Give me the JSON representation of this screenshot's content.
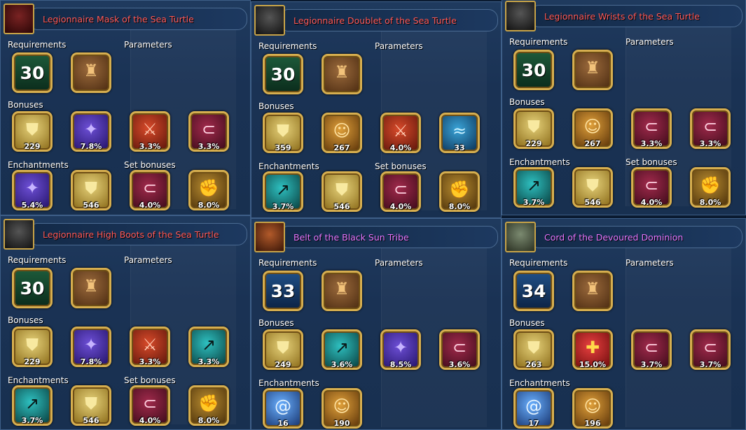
{
  "labels": {
    "requirements": "Requirements",
    "parameters": "Parameters",
    "bonuses": "Bonuses",
    "enchantments": "Enchantments",
    "set_bonuses": "Set bonuses"
  },
  "panels": [
    {
      "title": "Legionnaire Mask of the Sea Turtle",
      "title_color": "#ff5b5b",
      "level": "30",
      "bonuses": [
        "229",
        "7.8%",
        "3.3%",
        "3.3%"
      ],
      "bonus_icons": [
        "shield-icon",
        "magic-icon",
        "sword-icon",
        "crit-icon"
      ],
      "enchantments": [
        "5.4%",
        "546"
      ],
      "enchantment_icons": [
        "magic-icon",
        "shield-icon"
      ],
      "set_bonuses": [
        "4.0%",
        "8.0%"
      ],
      "set_bonus_icons": [
        "crit-icon",
        "arm-icon"
      ]
    },
    {
      "title": "Legionnaire Doublet of the Sea Turtle",
      "title_color": "#ff5b5b",
      "level": "30",
      "bonuses": [
        "359",
        "267",
        "4.0%",
        "33"
      ],
      "bonus_icons": [
        "shield-icon",
        "hero-icon",
        "sword-icon",
        "water-icon"
      ],
      "enchantments": [
        "3.7%",
        "546"
      ],
      "enchantment_icons": [
        "run-icon",
        "shield-icon"
      ],
      "set_bonuses": [
        "4.0%",
        "8.0%"
      ],
      "set_bonus_icons": [
        "crit-icon",
        "arm-icon"
      ]
    },
    {
      "title": "Legionnaire Wrists of the Sea Turtle",
      "title_color": "#ff5b5b",
      "level": "30",
      "bonuses": [
        "229",
        "267",
        "3.3%",
        "3.3%"
      ],
      "bonus_icons": [
        "shield-icon",
        "hero-icon",
        "crit-icon",
        "crit-icon"
      ],
      "enchantments": [
        "3.7%",
        "546"
      ],
      "enchantment_icons": [
        "run-icon",
        "shield-icon"
      ],
      "set_bonuses": [
        "4.0%",
        "8.0%"
      ],
      "set_bonus_icons": [
        "crit-icon",
        "arm-icon"
      ]
    },
    {
      "title": "Legionnaire High Boots of the Sea Turtle",
      "title_color": "#ff5b5b",
      "level": "30",
      "bonuses": [
        "229",
        "7.8%",
        "3.3%",
        "3.3%"
      ],
      "bonus_icons": [
        "shield-icon",
        "magic-icon",
        "sword-icon",
        "run-icon"
      ],
      "enchantments": [
        "3.7%",
        "546"
      ],
      "enchantment_icons": [
        "run-icon",
        "shield-icon"
      ],
      "set_bonuses": [
        "4.0%",
        "8.0%"
      ],
      "set_bonus_icons": [
        "crit-icon",
        "arm-icon"
      ]
    },
    {
      "title": "Belt of the Black Sun Tribe",
      "title_color": "#e577ff",
      "level": "33",
      "bonuses": [
        "249",
        "3.6%",
        "8.5%",
        "3.6%"
      ],
      "bonus_icons": [
        "shield-icon",
        "run-icon",
        "magic-icon",
        "crit-icon"
      ],
      "enchantments": [
        "16",
        "190"
      ],
      "enchantment_icons": [
        "swirl-icon",
        "hero-icon"
      ]
    },
    {
      "title": "Cord of the Devoured Dominion",
      "title_color": "#e577ff",
      "level": "34",
      "bonuses": [
        "263",
        "15.0%",
        "3.7%",
        "3.7%"
      ],
      "bonus_icons": [
        "shield-icon",
        "heart-icon",
        "crit-icon",
        "crit-icon"
      ],
      "enchantments": [
        "17",
        "196"
      ],
      "enchantment_icons": [
        "swirl-icon",
        "hero-icon"
      ]
    }
  ]
}
